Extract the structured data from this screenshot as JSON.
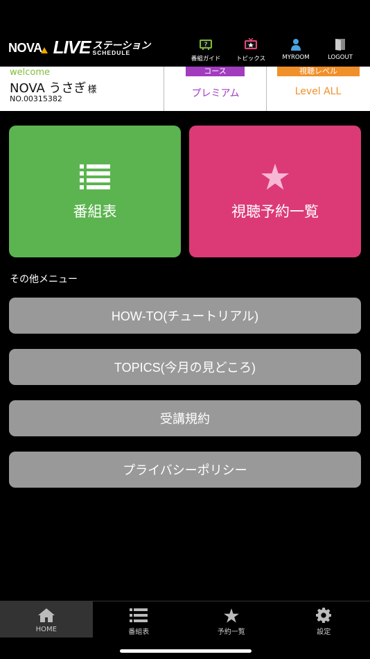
{
  "header": {
    "logo_nova": "NOVA",
    "logo_live": "LIVE",
    "logo_station": "ステーション",
    "logo_schedule": "SCHEDULE",
    "nav": [
      {
        "label": "番組ガイド",
        "icon": "guide-icon"
      },
      {
        "label": "トピックス",
        "icon": "tv-topics-icon"
      },
      {
        "label": "MYROOM",
        "icon": "person-icon"
      },
      {
        "label": "LOGOUT",
        "icon": "door-icon"
      }
    ]
  },
  "user": {
    "welcome": "welcome",
    "name": "NOVA うさぎ",
    "honorific": "様",
    "number": "NO.00315382",
    "course_tag": "コース",
    "course_value": "プレミアム",
    "level_tag": "視聴レベル",
    "level_value": "Level ALL"
  },
  "tiles": {
    "schedule": "番組表",
    "reservations": "視聴予約一覧"
  },
  "other_menu_label": "その他メニュー",
  "menu": {
    "howto": "HOW-TO(チュートリアル)",
    "topics": "TOPICS(今月の見どころ)",
    "terms": "受講規約",
    "privacy": "プライバシーポリシー"
  },
  "tabbar": [
    {
      "label": "HOME",
      "icon": "home-icon",
      "active": true
    },
    {
      "label": "番組表",
      "icon": "list-icon",
      "active": false
    },
    {
      "label": "予約一覧",
      "icon": "star-icon",
      "active": false
    },
    {
      "label": "設定",
      "icon": "gear-icon",
      "active": false
    }
  ],
  "colors": {
    "green": "#5cb450",
    "pink": "#dc3a77",
    "purple": "#a23cbf",
    "orange": "#f0902a",
    "menu_gray": "#999999"
  }
}
